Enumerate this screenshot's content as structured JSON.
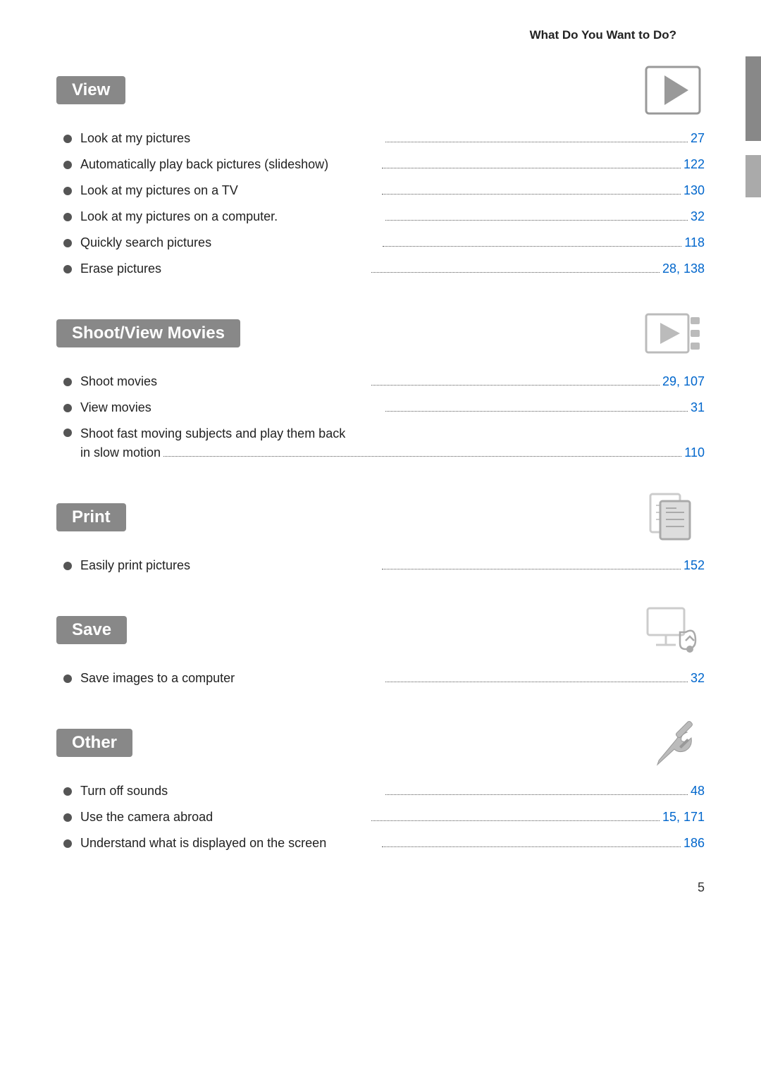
{
  "header": {
    "title": "What Do You Want to Do?"
  },
  "sections": [
    {
      "id": "view",
      "title": "View",
      "icon": "play-icon",
      "items": [
        {
          "label": "Look at my pictures",
          "dots": true,
          "page": "27"
        },
        {
          "label": "Automatically play back pictures (slideshow)",
          "dots": true,
          "page": "122"
        },
        {
          "label": "Look at my pictures on a TV",
          "dots": true,
          "page": "130"
        },
        {
          "label": "Look at my pictures on a computer.",
          "dots": true,
          "page": "32"
        },
        {
          "label": "Quickly search pictures",
          "dots": true,
          "page": "118"
        },
        {
          "label": "Erase pictures",
          "dots": true,
          "page": "28, 138"
        }
      ]
    },
    {
      "id": "shoot-view-movies",
      "title": "Shoot/View Movies",
      "icon": "movie-icon",
      "items": [
        {
          "label": "Shoot movies",
          "dots": true,
          "page": "29, 107"
        },
        {
          "label": "View movies",
          "dots": true,
          "page": "31"
        }
      ],
      "multilineItems": [
        {
          "line1": "Shoot fast moving subjects and play them back",
          "line2": "in slow motion",
          "dots": true,
          "page": "110"
        }
      ]
    },
    {
      "id": "print",
      "title": "Print",
      "icon": "print-icon",
      "items": [
        {
          "label": "Easily print pictures",
          "dots": true,
          "page": "152"
        }
      ]
    },
    {
      "id": "save",
      "title": "Save",
      "icon": "save-icon",
      "items": [
        {
          "label": "Save images to a computer",
          "dots": true,
          "page": "32"
        }
      ]
    },
    {
      "id": "other",
      "title": "Other",
      "icon": "tools-icon",
      "items": [
        {
          "label": "Turn off sounds",
          "dots": true,
          "page": "48"
        },
        {
          "label": "Use the camera abroad",
          "dots": true,
          "page": "15, 171"
        },
        {
          "label": "Understand what is displayed on the screen",
          "dots": true,
          "page": "186"
        }
      ]
    }
  ],
  "footer": {
    "page_number": "5"
  }
}
